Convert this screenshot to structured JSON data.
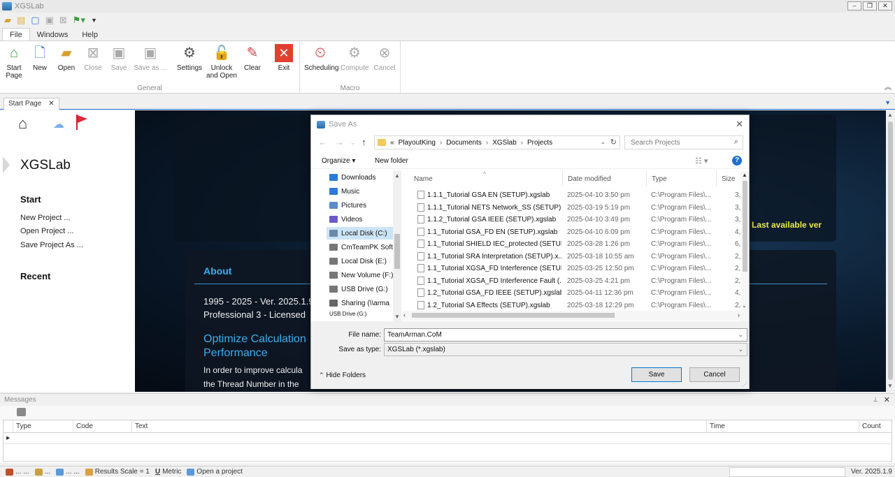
{
  "window": {
    "title": "XGSLab",
    "min": "–",
    "restore": "❐",
    "close": "✕"
  },
  "menu_tabs": [
    {
      "label": "File"
    },
    {
      "label": "Windows"
    },
    {
      "label": "Help"
    }
  ],
  "ribbon": {
    "general_label": "General",
    "macro_label": "Macro",
    "buttons": [
      {
        "label": "Start\nPage",
        "icon": "start-page-icon",
        "disabled": false
      },
      {
        "label": "New",
        "icon": "new-icon",
        "disabled": false
      },
      {
        "label": "Open",
        "icon": "open-folder-icon",
        "disabled": false
      },
      {
        "label": "Close",
        "icon": "close-icon",
        "disabled": true
      },
      {
        "label": "Save",
        "icon": "save-icon",
        "disabled": true
      },
      {
        "label": "Save as ...",
        "icon": "save-as-icon",
        "disabled": true
      },
      {
        "label": "Settings",
        "icon": "settings-icon",
        "disabled": false
      },
      {
        "label": "Unlock\nand Open",
        "icon": "unlock-icon",
        "disabled": false
      },
      {
        "label": "Clear",
        "icon": "eraser-icon",
        "disabled": false
      },
      {
        "label": "Exit",
        "icon": "exit-icon",
        "disabled": false
      },
      {
        "label": "Scheduling",
        "icon": "scheduling-icon",
        "disabled": false
      },
      {
        "label": "Compute",
        "icon": "compute-icon",
        "disabled": true
      },
      {
        "label": "Cancel",
        "icon": "cancel-icon",
        "disabled": true
      }
    ]
  },
  "doc_tab": {
    "label": "Start Page",
    "close": "✕"
  },
  "start_page": {
    "brand": "XGSLab",
    "start_heading": "Start",
    "links": [
      "New Project ...",
      "Open Project ...",
      "Save Project As ..."
    ],
    "recent_heading": "Recent",
    "about": "About",
    "version_line": "1995 - 2025 - Ver. 2025.1.9",
    "license_line": "Professional 3 - Licensed",
    "optimize_title_1": "Optimize Calculation",
    "optimize_title_2": "Performance",
    "body_1": "In order to improve calcula",
    "body_2": "the Thread Number in the",
    "last_version": "Last available ver"
  },
  "dialog": {
    "title": "Save As",
    "breadcrumb": [
      "«",
      "PlayoutKing",
      "Documents",
      "XGSlab",
      "Projects"
    ],
    "search_placeholder": "Search Projects",
    "organize": "Organize ▾",
    "new_folder": "New folder",
    "nav_items": [
      {
        "label": "Downloads",
        "color": "#2a7ad8"
      },
      {
        "label": "Music",
        "color": "#2a7ad8"
      },
      {
        "label": "Pictures",
        "color": "#5a8ac8"
      },
      {
        "label": "Videos",
        "color": "#6a5ac8"
      },
      {
        "label": "Local Disk (C:)",
        "color": "#6a8aa8",
        "selected": true
      },
      {
        "label": "CmTeamPK Soft",
        "color": "#777777"
      },
      {
        "label": "Local Disk (E:)",
        "color": "#777777"
      },
      {
        "label": "New Volume (F:)",
        "color": "#777777"
      },
      {
        "label": "USB Drive (G:)",
        "color": "#777777"
      },
      {
        "label": "Sharing (\\\\arma",
        "color": "#666666"
      },
      {
        "label": "USB Drive (G:)",
        "color": "#777777"
      }
    ],
    "columns": [
      "Name",
      "Date modified",
      "Type",
      "Size"
    ],
    "files": [
      {
        "name": "1.1.1_Tutorial GSA EN (SETUP).xgslab",
        "date": "2025-04-10 3:50 pm",
        "type": "C:\\Program Files\\...",
        "size": "3,("
      },
      {
        "name": "1.1.1_Tutorial NETS Network_SS (SETUP).x...",
        "date": "2025-03-19 5:19 pm",
        "type": "C:\\Program Files\\...",
        "size": "3,("
      },
      {
        "name": "1.1.2_Tutorial GSA IEEE (SETUP).xgslab",
        "date": "2025-04-10 3:49 pm",
        "type": "C:\\Program Files\\...",
        "size": "3,("
      },
      {
        "name": "1.1_Tutorial GSA_FD EN (SETUP).xgslab",
        "date": "2025-04-10 6:09 pm",
        "type": "C:\\Program Files\\...",
        "size": "4,("
      },
      {
        "name": "1.1_Tutorial SHIELD IEC_protected (SETUP....",
        "date": "2025-03-28 1:26 pm",
        "type": "C:\\Program Files\\...",
        "size": "6,"
      },
      {
        "name": "1.1_Tutorial SRA Interpretation (SETUP).x...",
        "date": "2025-03-18 10:55 am",
        "type": "C:\\Program Files\\...",
        "size": "2,"
      },
      {
        "name": "1.1_Tutorial XGSA_FD Interference (SETUP....",
        "date": "2025-03-25 12:50 pm",
        "type": "C:\\Program Files\\...",
        "size": "2,("
      },
      {
        "name": "1.1_Tutorial XGSA_FD Interference Fault (...",
        "date": "2025-03-25 4:21 pm",
        "type": "C:\\Program Files\\...",
        "size": "2,9"
      },
      {
        "name": "1.2_Tutorial GSA_FD IEEE (SETUP).xgslab",
        "date": "2025-04-11 12:36 pm",
        "type": "C:\\Program Files\\...",
        "size": "4,"
      },
      {
        "name": "1.2_Tutorial SA Effects (SETUP).xgslab",
        "date": "2025-03-18 12:29 pm",
        "type": "C:\\Program Files\\...",
        "size": "2,8"
      }
    ],
    "file_name_label": "File name:",
    "file_name_value": "TeamArman.CoM",
    "save_type_label": "Save as type:",
    "save_type_value": "XGSLab (*.xgslab)",
    "hide_folders": "Hide Folders",
    "save_button": "Save",
    "cancel_button": "Cancel"
  },
  "messages": {
    "title": "Messages",
    "columns": [
      "Type",
      "Code",
      "Text",
      "Time",
      "Count"
    ]
  },
  "status": {
    "dots_1": "...",
    "dots_2": "...",
    "dots_3": "...",
    "dots_4": "...",
    "dots_5": "...",
    "dots_6": "...",
    "results_scale": "Results Scale = 1",
    "metric": "Metric",
    "open_project": "Open a project",
    "version": "Ver. 2025.1.9"
  }
}
